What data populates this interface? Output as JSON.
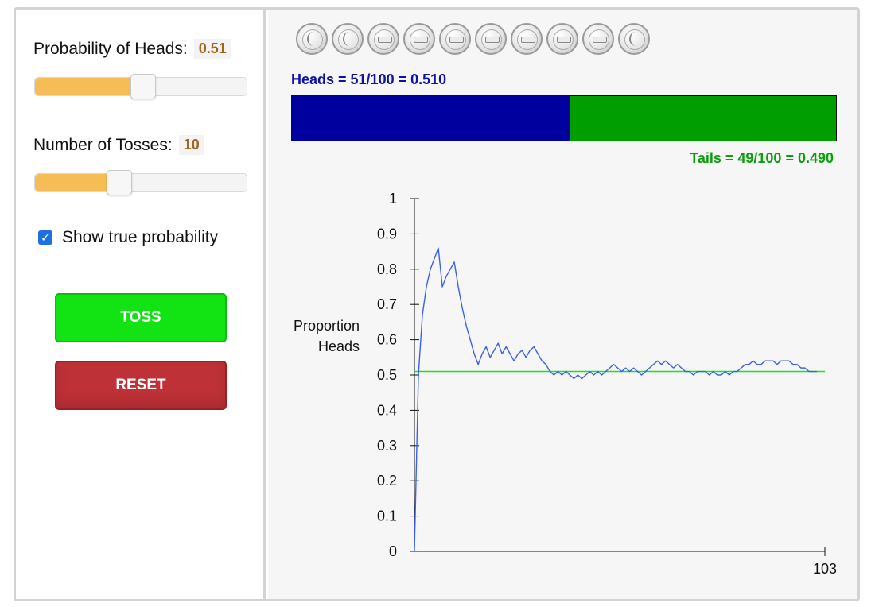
{
  "controls": {
    "prob_label": "Probability of Heads:",
    "prob_value": "0.51",
    "prob_slider_fraction": 0.51,
    "tosses_label": "Number of Tosses:",
    "tosses_value": "10",
    "tosses_slider_fraction": 0.38,
    "show_true_label": "Show true probability",
    "show_true_checked": true,
    "toss_button": "TOSS",
    "reset_button": "RESET"
  },
  "coins": [
    "heads",
    "heads",
    "tails",
    "tails",
    "tails",
    "tails",
    "tails",
    "tails",
    "tails",
    "heads"
  ],
  "results": {
    "heads_text": "Heads = 51/100 = 0.510",
    "tails_text": "Tails = 49/100 = 0.490",
    "heads_fraction": 0.51
  },
  "colors": {
    "heads": "#00009e",
    "tails": "#009e00",
    "line": "#3a62e8",
    "true_prob": "#22dd22",
    "toss": "#12e414",
    "reset": "#be3137",
    "slider_fill": "#f6bd56"
  },
  "chart_data": {
    "type": "line",
    "ylabel_lines": [
      "Proportion",
      "Heads"
    ],
    "xlim": [
      0,
      103
    ],
    "ylim": [
      0,
      1
    ],
    "x_tick_labels": [
      "103"
    ],
    "y_tick_labels": [
      "0",
      "0.1",
      "0.2",
      "0.3",
      "0.4",
      "0.5",
      "0.6",
      "0.7",
      "0.8",
      "0.9",
      "1"
    ],
    "true_probability": 0.51,
    "series": [
      {
        "values": [
          0,
          0.5,
          0.67,
          0.75,
          0.8,
          0.83,
          0.86,
          0.75,
          0.78,
          0.8,
          0.82,
          0.75,
          0.69,
          0.64,
          0.6,
          0.56,
          0.53,
          0.56,
          0.58,
          0.55,
          0.57,
          0.59,
          0.56,
          0.58,
          0.56,
          0.54,
          0.56,
          0.57,
          0.55,
          0.57,
          0.58,
          0.56,
          0.54,
          0.53,
          0.51,
          0.5,
          0.51,
          0.5,
          0.51,
          0.5,
          0.49,
          0.5,
          0.49,
          0.5,
          0.51,
          0.5,
          0.51,
          0.5,
          0.51,
          0.52,
          0.53,
          0.52,
          0.51,
          0.52,
          0.51,
          0.52,
          0.51,
          0.5,
          0.51,
          0.52,
          0.53,
          0.54,
          0.53,
          0.54,
          0.53,
          0.52,
          0.53,
          0.52,
          0.51,
          0.51,
          0.5,
          0.51,
          0.51,
          0.51,
          0.5,
          0.51,
          0.5,
          0.5,
          0.51,
          0.5,
          0.51,
          0.51,
          0.52,
          0.53,
          0.53,
          0.54,
          0.53,
          0.53,
          0.54,
          0.54,
          0.54,
          0.53,
          0.54,
          0.54,
          0.54,
          0.53,
          0.53,
          0.52,
          0.52,
          0.51,
          0.51,
          0.51
        ]
      }
    ]
  }
}
